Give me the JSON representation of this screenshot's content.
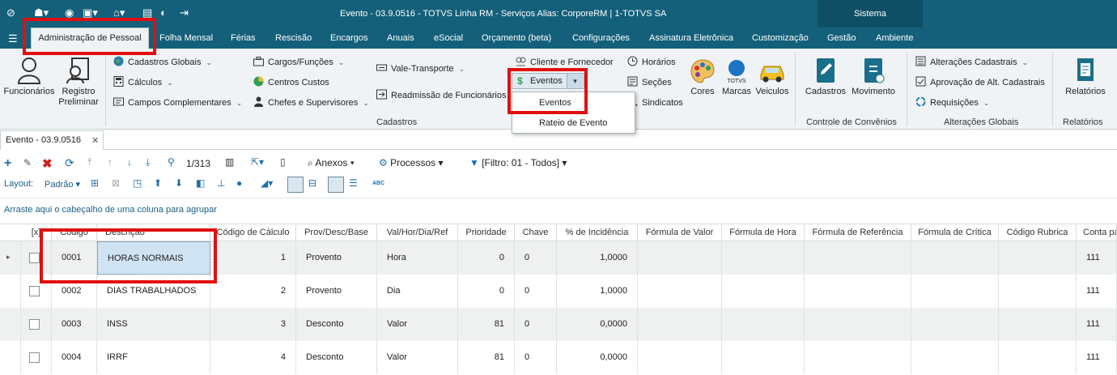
{
  "window": {
    "title": "Evento - 03.9.0516 - TOTVS Linha RM - Serviços  Alias: CorporeRM | 1-TOTVS SA",
    "system_label": "Sistema"
  },
  "menu": {
    "items": [
      "Administração de Pessoal",
      "Folha Mensal",
      "Férias",
      "Rescisão",
      "Encargos",
      "Anuais",
      "eSocial",
      "Orçamento (beta)",
      "Configurações",
      "Assinatura Eletrônica",
      "Customização",
      "Gestão",
      "Ambiente"
    ],
    "active": "Administração de Pessoal"
  },
  "ribbon": {
    "funcionarios": "Funcionários",
    "registro_preliminar_1": "Registro",
    "registro_preliminar_2": "Preliminar",
    "cadastros_globais": "Cadastros Globais",
    "calculos": "Cálculos",
    "campos_complementares": "Campos Complementares",
    "cargos_funcoes": "Cargos/Funções",
    "centros_custos": "Centros Custos",
    "chefes_supervisores": "Chefes e Supervisores",
    "vale_transporte": "Vale-Transporte",
    "readmissao": "Readmissão de Funcionários",
    "cliente_fornecedor": "Cliente e Fornecedor",
    "eventos": "Eventos",
    "horarios": "Horários",
    "secoes": "Seções",
    "sindicatos": "Sindicatos",
    "cores": "Cores",
    "marcas": "Marcas",
    "veiculos": "Veiculos",
    "marcas_logo": "TOTVS",
    "cadastros": "Cadastros",
    "movimento": "Movimento",
    "alteracoes_cadastrais": "Alterações Cadastrais",
    "aprovacao": "Aprovação de Alt. Cadastrais",
    "requisicoes": "Requisições",
    "relatorios": "Relatórios",
    "groups": {
      "cadastros": "Cadastros",
      "controle_convenios": "Controle de Convênios",
      "alteracoes_globais": "Alterações Globais",
      "relatorios": "Relatórios"
    }
  },
  "dropdown": {
    "items": [
      "Eventos",
      "Rateio de Evento"
    ]
  },
  "doc_tab": {
    "label": "Evento - 03.9.0516",
    "close": "✕"
  },
  "toolbar": {
    "record_pos": "1/313",
    "anexos": "Anexos",
    "processos": "Processos",
    "filtro": "[Filtro: 01 - Todos]"
  },
  "layout_bar": {
    "layout_label": "Layout:",
    "layout_value": "Padrão",
    "abc": "ABC"
  },
  "group_hint": "Arraste aqui o cabeçalho de uma coluna para agrupar",
  "grid": {
    "headers": [
      "[x]",
      "Código",
      "Descrição",
      "Código de Cálculo",
      "Prov/Desc/Base",
      "Val/Hor/Dia/Ref",
      "Prioridade",
      "Chave",
      "% de Incidência",
      "Fórmula de Valor",
      "Fórmula de Hora",
      "Fórmula de Referência",
      "Fórmula de Crítica",
      "Código Rubrica",
      "Conta pa"
    ],
    "rows": [
      {
        "codigo": "0001",
        "descricao": "HORAS NORMAIS",
        "codigo_calculo": "1",
        "prov": "Provento",
        "valhor": "Hora",
        "prioridade": "0",
        "chave": "0",
        "incidencia": "1,0000",
        "conta": "111"
      },
      {
        "codigo": "0002",
        "descricao": "DIAS TRABALHADOS",
        "codigo_calculo": "2",
        "prov": "Provento",
        "valhor": "Dia",
        "prioridade": "0",
        "chave": "0",
        "incidencia": "1,0000",
        "conta": "111"
      },
      {
        "codigo": "0003",
        "descricao": "INSS",
        "codigo_calculo": "3",
        "prov": "Desconto",
        "valhor": "Valor",
        "prioridade": "81",
        "chave": "0",
        "incidencia": "0,0000",
        "conta": "111"
      },
      {
        "codigo": "0004",
        "descricao": "IRRF",
        "codigo_calculo": "4",
        "prov": "Desconto",
        "valhor": "Valor",
        "prioridade": "81",
        "chave": "0",
        "incidencia": "0,0000",
        "conta": "111"
      }
    ]
  },
  "colors": {
    "titlebar": "#14607a",
    "ribbon_bg": "#f0f3f5",
    "highlight_red": "#e01010",
    "selected_cell": "#cfe3f3"
  }
}
